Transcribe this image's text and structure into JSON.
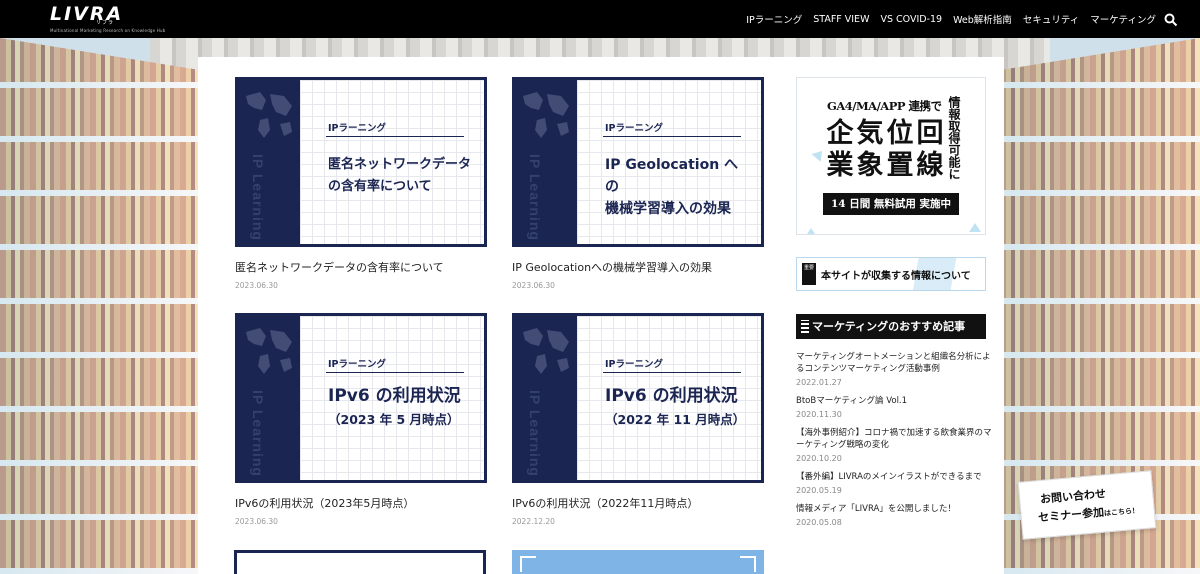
{
  "header": {
    "logo": "LIVRA",
    "logo_kana": "リブラ",
    "logo_tagline": "Multinational Marketing Research on Knowledge Hub",
    "nav": [
      "IPラーニング",
      "STAFF VIEW",
      "VS COVID-19",
      "Web解析指南",
      "セキュリティ",
      "マーケティング"
    ],
    "search_icon": "search-icon"
  },
  "articles": [
    {
      "category": "IPラーニング",
      "thumb_vertical": "IP Learning",
      "thumb_title_lines": [
        "匿名ネットワークデータ",
        "の含有率について"
      ],
      "title": "匿名ネットワークデータの含有率について",
      "date": "2023.06.30"
    },
    {
      "category": "IPラーニング",
      "thumb_vertical": "IP Learning",
      "thumb_title_lines": [
        "IP Geolocation への",
        "機械学習導入の効果"
      ],
      "title": "IP Geolocationへの機械学習導入の効果",
      "date": "2023.06.30"
    },
    {
      "category": "IPラーニング",
      "thumb_vertical": "IP Learning",
      "thumb_title_lines": [
        "IPv6 の利用状況",
        "（2023 年 5 月時点）"
      ],
      "title": "IPv6の利用状況（2023年5月時点）",
      "date": "2023.06.30"
    },
    {
      "category": "IPラーニング",
      "thumb_vertical": "IP Learning",
      "thumb_title_lines": [
        "IPv6 の利用状況",
        "（2022 年 11 月時点）"
      ],
      "title": "IPv6の利用状況（2022年11月時点）",
      "date": "2022.12.20"
    }
  ],
  "sidebar": {
    "ad": {
      "top": "GA4/MA/APP 連携で",
      "vertical": "情報取得可能に",
      "grid": [
        "企",
        "気",
        "位",
        "回",
        "業",
        "象",
        "置",
        "線"
      ],
      "banner": "14 日間 無料試用 実施中"
    },
    "info_badge": "重要",
    "info_link": "本サイトが収集する情報について",
    "recommend_heading": "マーケティングのおすすめ記事",
    "recommend": [
      {
        "title": "マーケティングオートメーションと組織名分析によるコンテンツマーケティング活動事例",
        "date": "2022.01.27"
      },
      {
        "title": "BtoBマーケティング論 Vol.1",
        "date": "2020.11.30"
      },
      {
        "title": "【海外事例紹介】コロナ禍で加速する飲食業界のマーケティング戦略の変化",
        "date": "2020.10.20"
      },
      {
        "title": "【番外編】LIVRAのメインイラストができるまで",
        "date": "2020.05.19"
      },
      {
        "title": "情報メディア「LIVRA」を公開しました！",
        "date": "2020.05.08"
      }
    ]
  },
  "contact": {
    "line1": "お問い合わせ",
    "line2": "セミナー参加",
    "line2_suffix": "はこちら！"
  },
  "colors": {
    "navy": "#1b2552",
    "header_bg": "#000000",
    "accent_blue": "#7fb4e6"
  }
}
